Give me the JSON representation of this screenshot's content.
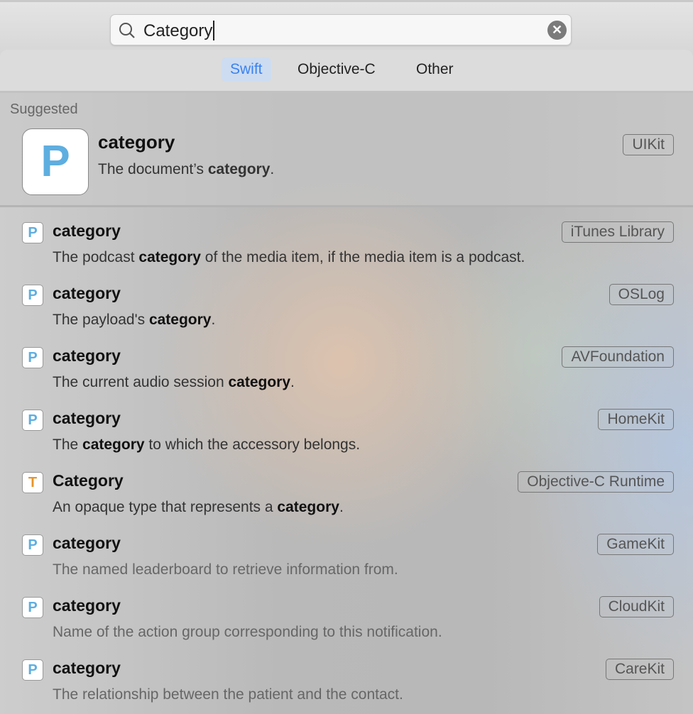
{
  "search": {
    "value": "Category",
    "icon": "magnifier-icon",
    "clear_icon": "clear-x-icon"
  },
  "tabs": [
    {
      "label": "Swift",
      "active": true
    },
    {
      "label": "Objective-C",
      "active": false
    },
    {
      "label": "Other",
      "active": false
    }
  ],
  "suggested": {
    "section_label": "Suggested",
    "icon_letter": "P",
    "title": "category",
    "desc_pre": "The document’s ",
    "desc_bold": "category",
    "desc_post": ".",
    "badge": "UIKit"
  },
  "results": [
    {
      "icon_letter": "P",
      "title": "category",
      "badge": "iTunes Library",
      "desc_pre": "The podcast ",
      "desc_bold": "category",
      "desc_post": " of the media item, if the media item is a podcast."
    },
    {
      "icon_letter": "P",
      "title": "category",
      "badge": "OSLog",
      "desc_pre": "The payload's ",
      "desc_bold": "category",
      "desc_post": "."
    },
    {
      "icon_letter": "P",
      "title": "category",
      "badge": "AVFoundation",
      "desc_pre": "The current audio session ",
      "desc_bold": "category",
      "desc_post": "."
    },
    {
      "icon_letter": "P",
      "title": "category",
      "badge": "HomeKit",
      "desc_pre": "The ",
      "desc_bold": "category",
      "desc_post": " to which the accessory belongs."
    },
    {
      "icon_letter": "T",
      "title": "Category",
      "badge": "Objective-C Runtime",
      "desc_pre": "An opaque type that represents a ",
      "desc_bold": "category",
      "desc_post": "."
    },
    {
      "icon_letter": "P",
      "title": "category",
      "badge": "GameKit",
      "desc_pre": "The named leaderboard to retrieve information from.",
      "desc_bold": "",
      "desc_post": ""
    },
    {
      "icon_letter": "P",
      "title": "category",
      "badge": "CloudKit",
      "desc_pre": "Name of the action group corresponding to this notification.",
      "desc_bold": "",
      "desc_post": ""
    },
    {
      "icon_letter": "P",
      "title": "category",
      "badge": "CareKit",
      "desc_pre": "The relationship between the patient and the contact.",
      "desc_bold": "",
      "desc_post": ""
    }
  ],
  "colors": {
    "accent": "#3b82f0",
    "property_icon": "#5eaee0",
    "type_icon": "#e6952a"
  }
}
